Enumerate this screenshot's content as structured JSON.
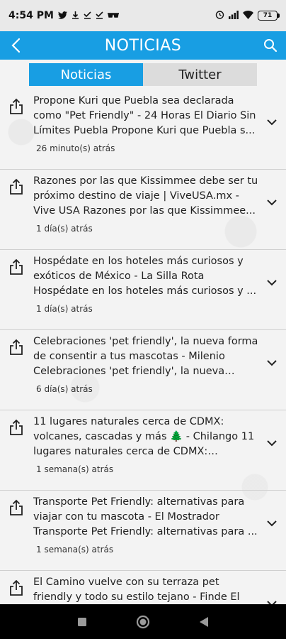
{
  "status_bar": {
    "time": "4:54 PM",
    "battery": "71"
  },
  "app_bar": {
    "title": "NOTICIAS"
  },
  "tabs": [
    {
      "label": "Noticias",
      "active": true
    },
    {
      "label": "Twitter",
      "active": false
    }
  ],
  "news": [
    {
      "title": "Propone Kuri que Puebla sea declarada como \"Pet Friendly\" - 24 Horas El Diario Sin Límites Puebla Propone Kuri que Puebla s...",
      "time": "26 minuto(s) atrás"
    },
    {
      "title": "Razones por las que Kissimmee debe ser tu próximo destino de viaje | ViveUSA.mx - Vive USA Razones por las que Kissimmee...",
      "time": "1 día(s) atrás"
    },
    {
      "title": "Hospédate en los hoteles más curiosos y exóticos de México - La Silla Rota Hospédate en los hoteles más curiosos y ...",
      "time": "1 día(s) atrás"
    },
    {
      "title": "Celebraciones 'pet friendly', la nueva forma de consentir a tus mascotas - Milenio Celebraciones 'pet friendly', la nueva form...",
      "time": "6 día(s) atrás"
    },
    {
      "title": "11 lugares naturales cerca de CDMX: volcanes, cascadas y más 🌲 - Chilango 11 lugares naturales cerca de CDMX: volcane...",
      "time": "1 semana(s) atrás"
    },
    {
      "title": "Transporte Pet Friendly: alternativas para viajar con tu mascota - El Mostrador Transporte Pet Friendly: alternativas para ...",
      "time": "1 semana(s) atrás"
    },
    {
      "title": "El Camino vuelve con su terraza pet friendly y todo su estilo tejano - Finde El Camino vuelve con su terraza pet friendly...",
      "time": ""
    }
  ],
  "colors": {
    "accent": "#189ee3"
  }
}
